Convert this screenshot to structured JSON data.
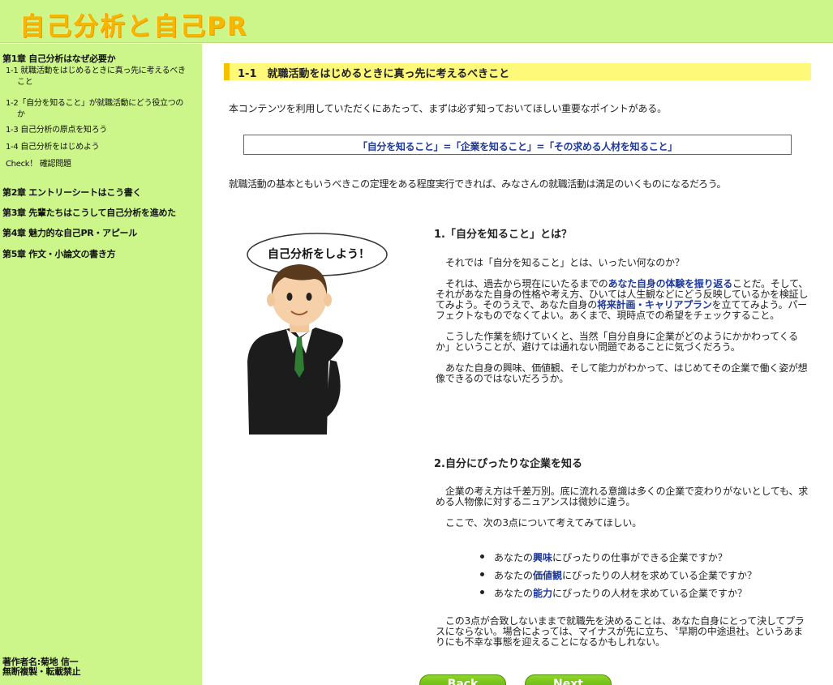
{
  "header": {
    "site_title": "自己分析と自己PR"
  },
  "sidebar": {
    "chapter1": "第1章 自己分析はなぜ必要か",
    "sub_items": [
      {
        "lines": [
          "1-1 就職活動をはじめるときに真っ先に考えるべき",
          "こと"
        ]
      },
      {
        "lines": [
          "1-2「自分を知ること」が就職活動にどう役立つの",
          "か"
        ]
      },
      {
        "lines": [
          "1-3 自己分析の原点を知ろう"
        ]
      },
      {
        "lines": [
          "1-4 自己分析をはじめよう"
        ]
      },
      {
        "lines": [
          "Check！ 確認問題"
        ]
      }
    ],
    "chapters": [
      "第2章 エントリーシートはこう書く",
      "第3章 先輩たちはこうして自己分析を進めた",
      "第4章 魅力的な自己PR・アピール",
      "第5章 作文・小論文の書き方"
    ],
    "author_line1": "著作者名:菊地 信一",
    "author_line2": "無断複製・転載禁止"
  },
  "main": {
    "section_title": "1-1　就職活動をはじめるときに真っ先に考えるべきこと",
    "intro": "本コンテンツを利用していただくにあたって、まずは必ず知っておいてほしい重要なポイントがある。",
    "theorem": "「自分を知ること」=「企業を知ること」=「その求める人材を知ること」",
    "summary": "就職活動の基本ともいうべきこの定理をある程度実行できれば、みなさんの就職活動は満足のいくものになるだろう。",
    "speech_bubble": "自己分析をしよう！",
    "section1": {
      "heading": "1.「自分を知ること」とは？",
      "p1": "それでは「自分を知ること」とは、いったい何なのか？",
      "p2_a": "それは、過去から現在にいたるまでの",
      "p2_hl1": "あなた自身の体験を振り返る",
      "p2_b": "ことだ。そして、それがあなた自身の性格や考え方、ひいては人生観などにどう反映しているかを検証してみよう。そのうえで、あなた自身の",
      "p2_hl2": "将来計画・キャリアプラン",
      "p2_c": "を立ててみよう。パーフェクトなものでなくてよい。あくまで、現時点での希望をチェックすること。",
      "p3": "こうした作業を続けていくと、当然「自分自身に企業がどのようにかかわってくるか」ということが、避けては通れない問題であることに気づくだろう。",
      "p4": "あなた自身の興味、価値観、そして能力がわかって、はじめてその企業で働く姿が想像できるのではないだろうか。"
    },
    "section2": {
      "heading": "2.自分にぴったりな企業を知る",
      "p1": "企業の考え方は千差万別。底に流れる意識は多くの企業で変わりがないとしても、求める人物像に対するニュアンスは微妙に違う。",
      "p2": "ここで、次の3点について考えてみてほしい。",
      "bullets": [
        {
          "pre": "あなたの",
          "hl": "興味",
          "post": "にぴったりの仕事ができる企業ですか？"
        },
        {
          "pre": "あなたの",
          "hl": "価値観",
          "post": "にぴったりの人材を求めている企業ですか？"
        },
        {
          "pre": "あなたの",
          "hl": "能力",
          "post": "にぴったりの人材を求めている企業ですか？"
        }
      ],
      "p3": "この3点が合致しないままで就職先を決めることは、あなた自身にとって決してプラスにならない。場合によっては、マイナスが先に立ち、〝早期の中途退社〟というあまりにも不幸な事態を迎えることになるかもしれない。"
    },
    "back_label": "Back",
    "next_label": "Next"
  },
  "colors": {
    "header_bg": "#ccf58a",
    "title_yellow": "#f5b800",
    "heading_bg": "#fff97a",
    "link_blue": "#1f3a9a",
    "button_green": "#6ab817"
  }
}
